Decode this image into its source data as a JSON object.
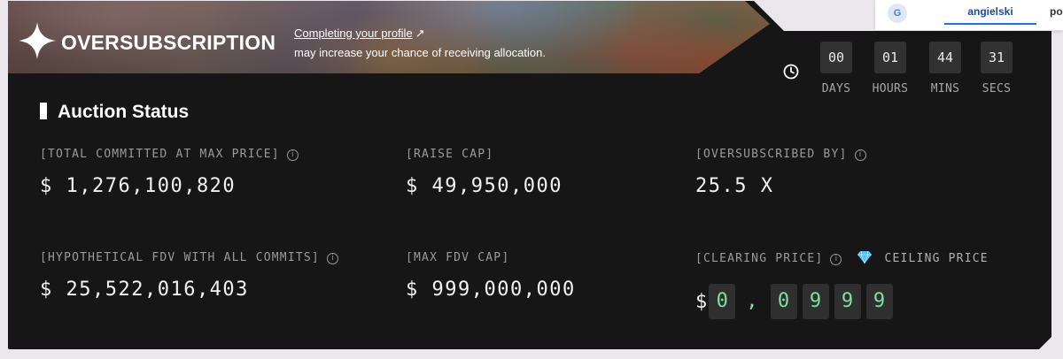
{
  "banner": {
    "title": "OVERSUBSCRIPTION",
    "link_label": "Completing your profile",
    "link_arrow": "↗",
    "subtitle": "may increase your chance of receiving allocation."
  },
  "countdown": [
    {
      "value": "00",
      "label": "DAYS"
    },
    {
      "value": "01",
      "label": "HOURS"
    },
    {
      "value": "44",
      "label": "MINS"
    },
    {
      "value": "31",
      "label": "SECS"
    }
  ],
  "auction": {
    "title": "Auction Status",
    "stats": [
      {
        "label": "[TOTAL COMMITTED AT MAX PRICE]",
        "value": "$ 1,276,100,820",
        "info": true
      },
      {
        "label": "[RAISE CAP]",
        "value": "$ 49,950,000",
        "info": false
      },
      {
        "label": "[OVERSUBSCRIBED BY]",
        "value": "25.5 X",
        "info": true
      },
      {
        "label": "[HYPOTHETICAL FDV WITH ALL COMMITS]",
        "value": "$ 25,522,016,403",
        "info": true
      },
      {
        "label": "[MAX FDV CAP]",
        "value": "$ 999,000,000",
        "info": false
      }
    ],
    "clearing": {
      "label": "[CLEARING PRICE]",
      "ceiling_label": "CEILING PRICE",
      "currency": "$",
      "int_digits": [
        "0"
      ],
      "separator": ",",
      "frac_digits": [
        "0",
        "9",
        "9",
        "9"
      ]
    }
  },
  "translate": {
    "icon": "G",
    "tab_active": "angielski",
    "tab_other": "polsk"
  },
  "colors": {
    "accent_digits": "#7ee0a0",
    "panel_bg": "#161616",
    "diamond": "#4fc3f7"
  },
  "icons": {
    "info": "i",
    "clock": "clock-icon",
    "star": "four-point-star-icon",
    "diamond": "diamond-icon"
  }
}
